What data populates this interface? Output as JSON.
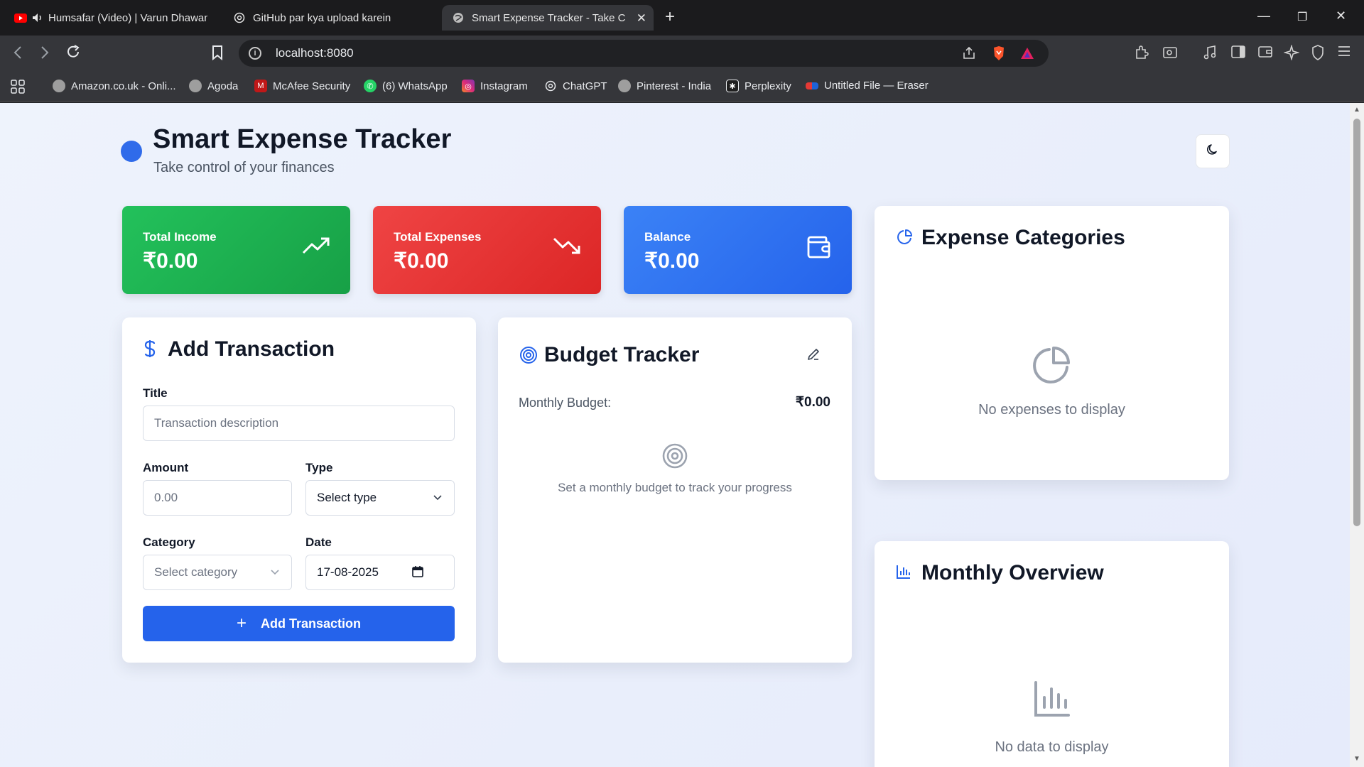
{
  "browser": {
    "tabs": [
      {
        "title": "Humsafar (Video) | Varun Dhawan"
      },
      {
        "title": "GitHub par kya upload karein"
      },
      {
        "title": "Smart Expense Tracker - Take Control"
      }
    ],
    "url": "localhost:8080",
    "bookmarks": [
      {
        "label": "Amazon.co.uk - Onli..."
      },
      {
        "label": "Agoda"
      },
      {
        "label": "McAfee Security"
      },
      {
        "label": "(6) WhatsApp"
      },
      {
        "label": "Instagram"
      },
      {
        "label": "ChatGPT"
      },
      {
        "label": "Pinterest - India"
      },
      {
        "label": "Perplexity"
      },
      {
        "label": "Untitled File — Eraser"
      }
    ]
  },
  "app": {
    "title": "Smart Expense Tracker",
    "subtitle": "Take control of your finances"
  },
  "stats": {
    "income": {
      "label": "Total Income",
      "value": "₹0.00"
    },
    "expenses": {
      "label": "Total Expenses",
      "value": "₹0.00"
    },
    "balance": {
      "label": "Balance",
      "value": "₹0.00"
    }
  },
  "add_transaction": {
    "title": "Add Transaction",
    "title_label": "Title",
    "title_placeholder": "Transaction description",
    "amount_label": "Amount",
    "amount_placeholder": "0.00",
    "type_label": "Type",
    "type_value": "Select type",
    "category_label": "Category",
    "category_value": "Select category",
    "date_label": "Date",
    "date_value": "17-08-2025",
    "button": "Add Transaction"
  },
  "budget": {
    "title": "Budget Tracker",
    "monthly_label": "Monthly Budget:",
    "monthly_value": "₹0.00",
    "empty": "Set a monthly budget to track your progress"
  },
  "expense_categories": {
    "title": "Expense Categories",
    "empty": "No expenses to display"
  },
  "monthly_overview": {
    "title": "Monthly Overview",
    "empty": "No data to display"
  },
  "colors": {
    "income": "#22c55e",
    "expense": "#ef4444",
    "balance": "#3b82f6",
    "accent": "#2563eb"
  }
}
